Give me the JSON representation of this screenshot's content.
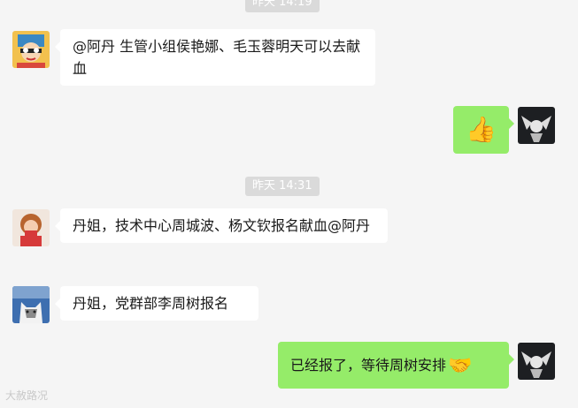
{
  "timestamps": [
    "昨天 14:19",
    "昨天 14:31"
  ],
  "messages": [
    {
      "sender": "other",
      "text": "@阿丹 生管小组侯艳娜、毛玉蓉明天可以去献血"
    },
    {
      "sender": "self",
      "emoji": "thumbs-up",
      "text": "👍"
    },
    {
      "sender": "other",
      "text": "丹姐，技术中心周城波、杨文钦报名献血@阿丹"
    },
    {
      "sender": "other",
      "text": "丹姐，党群部李周树报名"
    },
    {
      "sender": "self",
      "text": "已经报了，等待周树安排",
      "emoji": "handshake",
      "emoji_glyph": "🤝"
    }
  ],
  "watermark": "大赦路况",
  "colors": {
    "background": "#f5f5f5",
    "self_bubble": "#95ec69",
    "other_bubble": "#ffffff",
    "time_badge": "#dadada"
  }
}
